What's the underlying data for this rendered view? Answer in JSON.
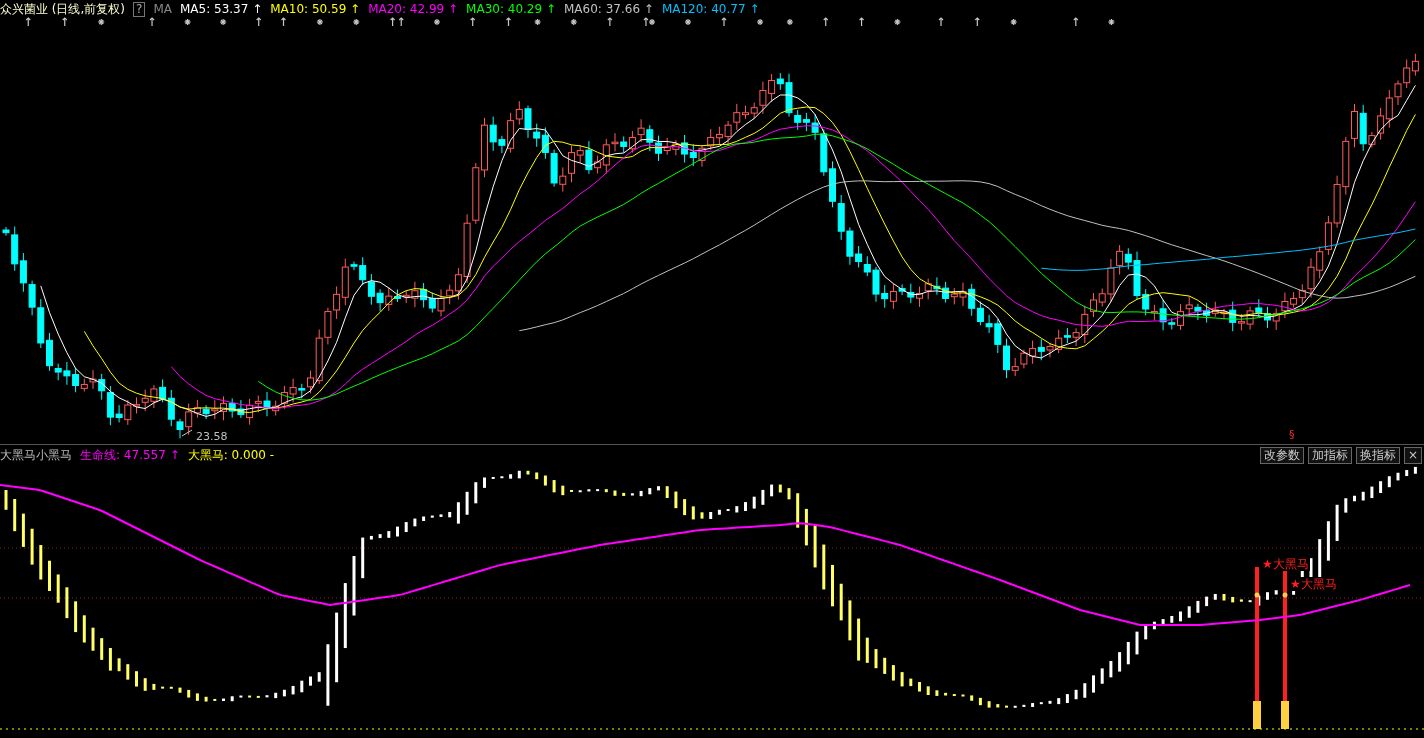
{
  "main_chart": {
    "stock_name": "众兴菌业",
    "period": "(日线,前复权)",
    "help": "?",
    "indicator": "MA",
    "ma_lines": [
      {
        "name": "MA5:",
        "value": "53.37",
        "trend": "↑",
        "color": "#ffffff"
      },
      {
        "name": "MA10:",
        "value": "50.59",
        "trend": "↑",
        "color": "#ffff00"
      },
      {
        "name": "MA20:",
        "value": "42.99",
        "trend": "↑",
        "color": "#ff00ff"
      },
      {
        "name": "MA30:",
        "value": "40.29",
        "trend": "↑",
        "color": "#00ff00"
      },
      {
        "name": "MA60:",
        "value": "37.66",
        "trend": "↑",
        "color": "#c0c0c0"
      },
      {
        "name": "MA120:",
        "value": "40.77",
        "trend": "↑",
        "color": "#00c0ff"
      }
    ],
    "low_label": "23.58",
    "signal_mark": "§"
  },
  "indicator_panel": {
    "name": "大黑马小黑马",
    "lines": [
      {
        "name": "生命线:",
        "value": "47.557",
        "trend": "↑",
        "color": "#ff00ff"
      },
      {
        "name": "大黑马:",
        "value": "0.000",
        "trend": "-",
        "color": "#ffff00"
      }
    ],
    "buttons": [
      "改参数",
      "加指标",
      "换指标"
    ],
    "close": "×",
    "signal_labels": [
      "★大黑马",
      "★大黑马"
    ]
  }
}
